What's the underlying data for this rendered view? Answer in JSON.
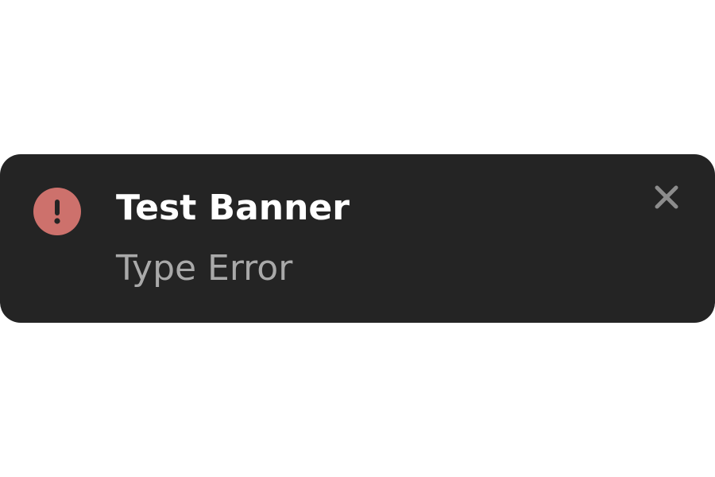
{
  "banner": {
    "title": "Test Banner",
    "subtitle": "Type Error",
    "icon": "error-exclamation-icon",
    "close_icon": "close-icon",
    "colors": {
      "background": "#242424",
      "icon_fill": "#cd716c",
      "title": "#ffffff",
      "subtitle": "#a9a9a9",
      "close": "#8c8c8c"
    }
  }
}
